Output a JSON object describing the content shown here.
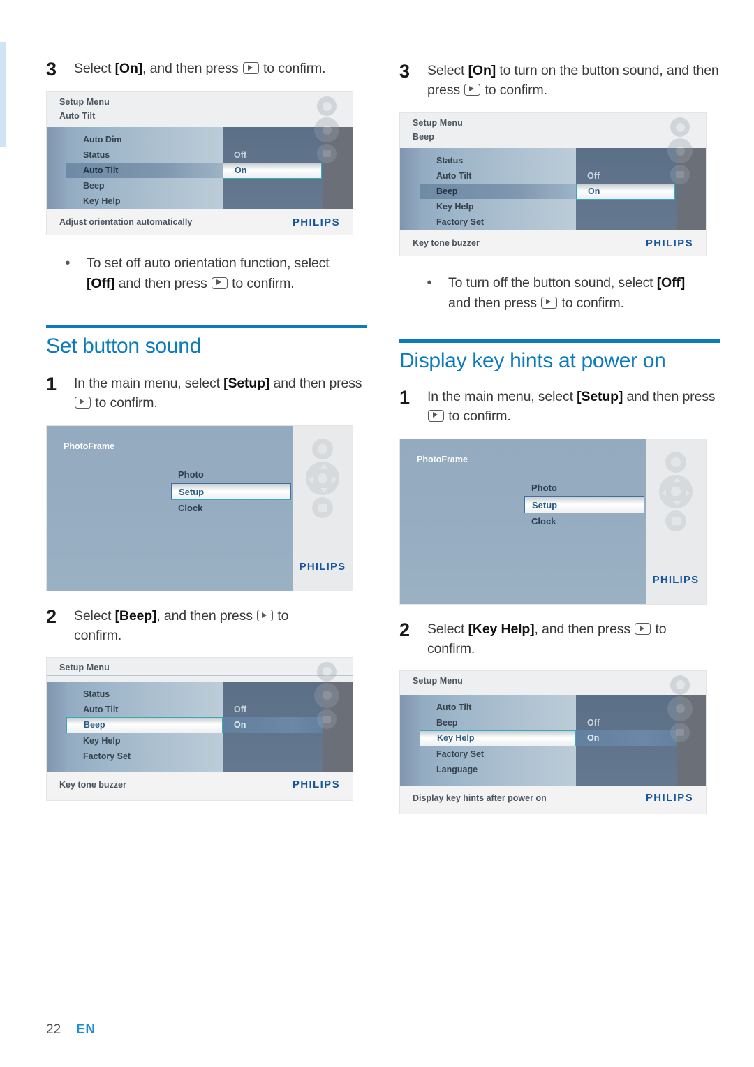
{
  "page": {
    "number": "22",
    "language": "EN"
  },
  "left_column": {
    "step3": {
      "num": "3",
      "text_before": "Select ",
      "bold": "[On]",
      "text_mid": ", and then press ",
      "text_after": " to confirm."
    },
    "screen_auto_tilt": {
      "header_line1": "Setup Menu",
      "header_line2": "Auto Tilt",
      "menu_items": [
        "Auto Dim",
        "Status",
        "Auto Tilt",
        "Beep",
        "Key Help"
      ],
      "highlighted_item": "Auto Tilt",
      "options": [
        "Off",
        "On"
      ],
      "selected_option": "On",
      "footer_hint": "Adjust orientation automatically",
      "brand": "PHILIPS"
    },
    "bullet": {
      "dot": "•",
      "text_before": "To set off auto orientation function, select ",
      "bold": "[Off]",
      "text_mid": " and then press ",
      "text_after": " to confirm."
    },
    "section": {
      "title": "Set button sound"
    },
    "step1": {
      "num": "1",
      "text_before": "In the main menu, select ",
      "bold": "[Setup]",
      "text_mid": " and then press ",
      "text_after": " to confirm."
    },
    "screen_main_menu": {
      "title": "PhotoFrame",
      "items": [
        "Photo",
        "Setup",
        "Clock"
      ],
      "selected_item": "Setup",
      "brand": "PHILIPS"
    },
    "step2": {
      "num": "2",
      "text_before": "Select ",
      "bold": "[Beep]",
      "text_mid": ", and then press ",
      "text_after": " to confirm."
    },
    "screen_setup_beep": {
      "header_line1": "Setup Menu",
      "header_line2": "",
      "menu_items": [
        "Status",
        "Auto Tilt",
        "Beep",
        "Key Help",
        "Factory Set"
      ],
      "highlighted_item": "Beep",
      "options": [
        "Off",
        "On"
      ],
      "selected_option": "On",
      "footer_hint": "Key tone buzzer",
      "brand": "PHILIPS"
    }
  },
  "right_column": {
    "step3": {
      "num": "3",
      "text_before": "Select ",
      "bold": "[On]",
      "text_mid": " to turn on the button sound, and then press ",
      "text_after": " to confirm."
    },
    "screen_beep": {
      "header_line1": "Setup Menu",
      "header_line2": "Beep",
      "menu_items": [
        "Status",
        "Auto Tilt",
        "Beep",
        "Key Help",
        "Factory Set"
      ],
      "highlighted_item": "Beep",
      "options": [
        "Off",
        "On"
      ],
      "selected_option": "On",
      "footer_hint": "Key tone buzzer",
      "brand": "PHILIPS"
    },
    "bullet": {
      "dot": "•",
      "text_before": "To turn off the button sound, select ",
      "bold": "[Off]",
      "text_mid": " and then press ",
      "text_after": " to confirm."
    },
    "section": {
      "title": "Display key hints at power on"
    },
    "step1": {
      "num": "1",
      "text_before": "In the main menu, select ",
      "bold": "[Setup]",
      "text_mid": " and then press ",
      "text_after": " to confirm."
    },
    "screen_main_menu": {
      "title": "PhotoFrame",
      "items": [
        "Photo",
        "Setup",
        "Clock"
      ],
      "selected_item": "Setup",
      "brand": "PHILIPS"
    },
    "step2": {
      "num": "2",
      "text_before": "Select ",
      "bold": "[Key Help]",
      "text_mid": ", and then press ",
      "text_after": " to confirm."
    },
    "screen_setup_keyhelp": {
      "header_line1": "Setup Menu",
      "header_line2": "",
      "menu_items": [
        "Auto Tilt",
        "Beep",
        "Key Help",
        "Factory Set",
        "Language"
      ],
      "highlighted_item": "Key Help",
      "options": [
        "Off",
        "On"
      ],
      "selected_option": "On",
      "footer_hint": "Display key hints after power on",
      "brand": "PHILIPS"
    }
  },
  "colors": {
    "accent_blue": "#0b7bbd",
    "link_blue": "#1f8fd4",
    "philips_blue": "#17569e",
    "highlight_teal": "#3aa9b5"
  }
}
